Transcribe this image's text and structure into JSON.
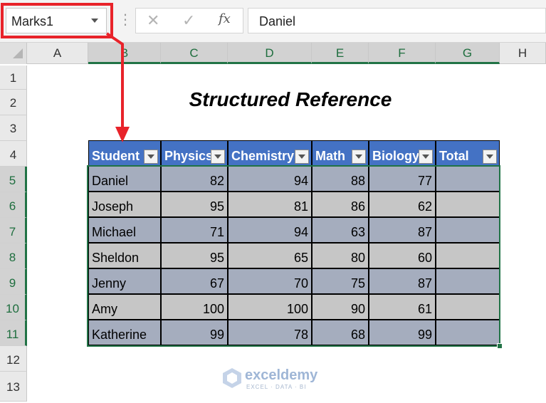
{
  "formula_bar": {
    "name_box": "Marks1",
    "formula": "Daniel",
    "cancel_icon": "✕",
    "enter_icon": "✓",
    "fx_label": "fx"
  },
  "columns": [
    "A",
    "B",
    "C",
    "D",
    "E",
    "F",
    "G",
    "H"
  ],
  "rows": [
    "1",
    "2",
    "3",
    "4",
    "5",
    "6",
    "7",
    "8",
    "9",
    "10",
    "11",
    "12",
    "13"
  ],
  "title": "Structured Reference",
  "table": {
    "headers": [
      "Student",
      "Physics",
      "Chemistry",
      "Math",
      "Biology",
      "Total"
    ],
    "rows": [
      [
        "Daniel",
        "82",
        "94",
        "88",
        "77",
        ""
      ],
      [
        "Joseph",
        "95",
        "81",
        "86",
        "62",
        ""
      ],
      [
        "Michael",
        "71",
        "94",
        "63",
        "87",
        ""
      ],
      [
        "Sheldon",
        "95",
        "65",
        "80",
        "60",
        ""
      ],
      [
        "Jenny",
        "67",
        "70",
        "75",
        "87",
        ""
      ],
      [
        "Amy",
        "100",
        "100",
        "90",
        "61",
        ""
      ],
      [
        "Katherine",
        "99",
        "78",
        "68",
        "99",
        ""
      ]
    ]
  },
  "watermark": {
    "name": "exceldemy",
    "tagline": "EXCEL · DATA · BI"
  },
  "colors": {
    "header_blue": "#4472c4",
    "band_gray": "#a5adbe",
    "band_silver": "#c6c6c6",
    "highlight_red": "#e8232a",
    "excel_green": "#217346"
  }
}
